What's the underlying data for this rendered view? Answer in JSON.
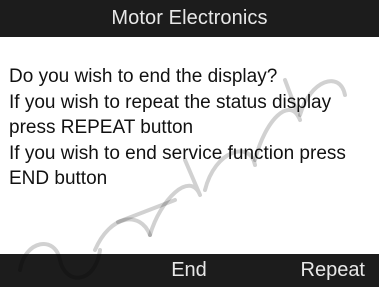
{
  "header": {
    "title": "Motor Electronics"
  },
  "message": {
    "lines": [
      "Do you wish to end the display?",
      "If you wish to repeat the status display",
      "press REPEAT button",
      "If you wish to end service function press",
      "END button"
    ]
  },
  "softkeys": {
    "left_label": "",
    "middle_label": "End",
    "right_label": "Repeat"
  },
  "colors": {
    "bar_background": "#1c1c1c",
    "bar_text": "#e8e8e8",
    "body_text": "#111111",
    "background": "#ffffff"
  }
}
